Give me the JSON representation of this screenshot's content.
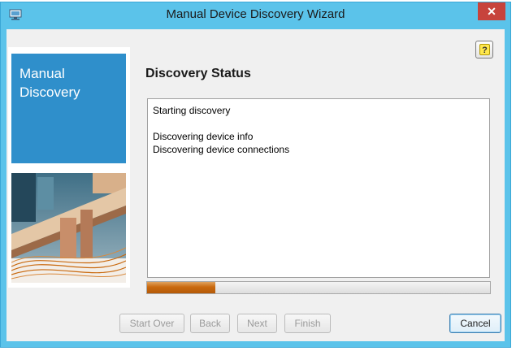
{
  "window": {
    "title": "Manual Device Discovery Wizard",
    "close_glyph": "✕",
    "icon": "computer-icon"
  },
  "help_button": {
    "glyph": "?",
    "icon": "help-icon"
  },
  "side_panel": {
    "line1": "Manual",
    "line2": "Discovery",
    "accent_color": "#2f8fcb"
  },
  "main": {
    "heading": "Discovery Status",
    "status_lines": [
      "Starting discovery",
      "",
      "Discovering device info",
      "Discovering device connections"
    ]
  },
  "progress": {
    "fraction": 0.2,
    "color": "#c9690e"
  },
  "buttons": {
    "start_over": "Start Over",
    "back": "Back",
    "next": "Next",
    "finish": "Finish",
    "cancel": "Cancel"
  }
}
